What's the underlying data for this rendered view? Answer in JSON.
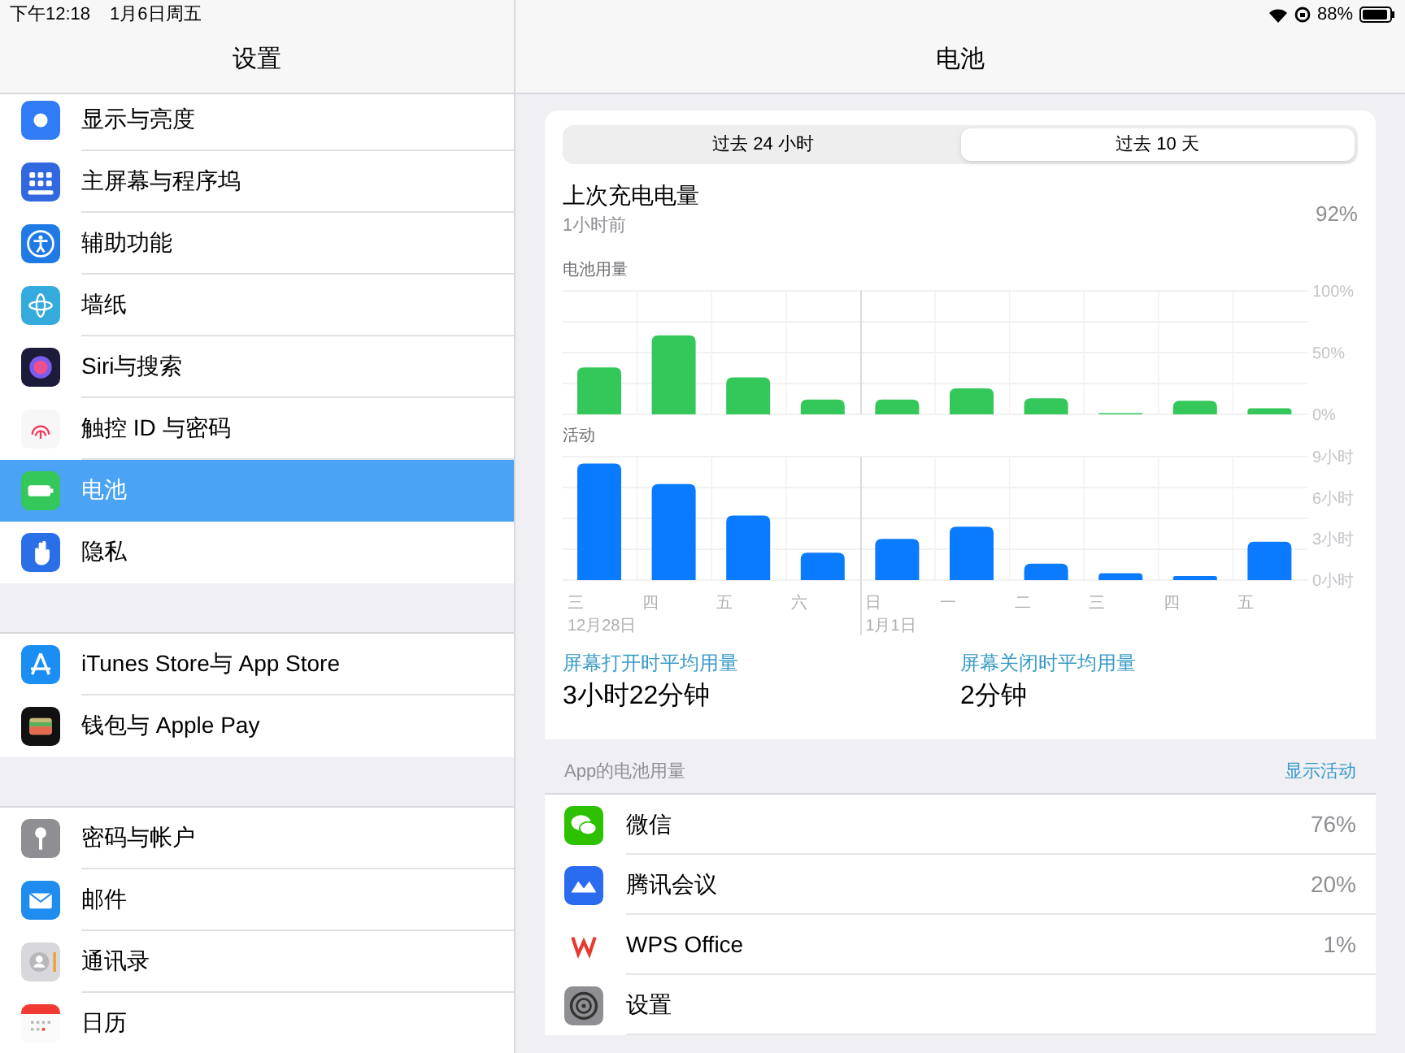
{
  "status_bar": {
    "time": "下午12:18",
    "date": "1月6日周五",
    "battery": "88%"
  },
  "sidebar": {
    "title": "设置",
    "groups": [
      [
        {
          "kind": "display",
          "label": "显示与亮度",
          "selected": false
        },
        {
          "kind": "home",
          "label": "主屏幕与程序坞",
          "selected": false
        },
        {
          "kind": "accessibility",
          "label": "辅助功能",
          "selected": false
        },
        {
          "kind": "wallpaper",
          "label": "墙纸",
          "selected": false
        },
        {
          "kind": "siri",
          "label": "Siri与搜索",
          "selected": false
        },
        {
          "kind": "touchid",
          "label": "触控 ID 与密码",
          "selected": false
        },
        {
          "kind": "battery",
          "label": "电池",
          "selected": true
        },
        {
          "kind": "privacy",
          "label": "隐私",
          "selected": false
        }
      ],
      [
        {
          "kind": "appstore",
          "label": "iTunes Store与 App Store",
          "selected": false
        },
        {
          "kind": "wallet",
          "label": "钱包与 Apple Pay",
          "selected": false
        }
      ],
      [
        {
          "kind": "key",
          "label": "密码与帐户",
          "selected": false
        },
        {
          "kind": "mail",
          "label": "邮件",
          "selected": false
        },
        {
          "kind": "contacts",
          "label": "通讯录",
          "selected": false
        },
        {
          "kind": "calendar",
          "label": "日历",
          "selected": false
        }
      ]
    ]
  },
  "detail": {
    "title": "电池",
    "tabs": [
      {
        "label": "过去 24 小时",
        "selected": false
      },
      {
        "label": "过去 10 天",
        "selected": true
      }
    ],
    "last_charge": {
      "label": "上次充电电量",
      "time": "1小时前",
      "value": "92%"
    },
    "battery_chart": {
      "chart_data": {
        "type": "bar",
        "title": "电池用量",
        "series": [
          {
            "color": "#34c759",
            "values": [
              38,
              64,
              30,
              12,
              12,
              21,
              13,
              1,
              11,
              5
            ]
          }
        ],
        "ylim": [
          0,
          100
        ],
        "yticks": [
          {
            "value": 0,
            "label": "0%"
          },
          {
            "value": 50,
            "label": "50%"
          },
          {
            "value": 100,
            "label": "100%"
          }
        ]
      }
    },
    "activity_chart": {
      "chart_data": {
        "type": "bar",
        "title": "活动",
        "categories": [
          "三",
          "四",
          "五",
          "六",
          "日",
          "一",
          "二",
          "三",
          "四",
          "五"
        ],
        "series": [
          {
            "color": "#0a7aff",
            "values": [
              8.5,
              7,
              4.7,
              2,
              3,
              3.9,
              1.2,
              0.5,
              0.3,
              2.8
            ]
          }
        ],
        "ylim": [
          0,
          9
        ],
        "yticks": [
          {
            "value": 0,
            "label": "0小时"
          },
          {
            "value": 3,
            "label": "3小时"
          },
          {
            "value": 6,
            "label": "6小时"
          },
          {
            "value": 9,
            "label": "9小时"
          }
        ],
        "annotations": [
          "12月28日",
          "1月1日"
        ]
      }
    },
    "stats": [
      {
        "label": "屏幕打开时平均用量",
        "value": "3小时22分钟"
      },
      {
        "label": "屏幕关闭时平均用量",
        "value": "2分钟"
      }
    ],
    "apps_header": {
      "label": "App的电池用量",
      "action": "显示活动"
    },
    "apps": [
      {
        "kind": "wechat",
        "name": "微信",
        "percent": "76%"
      },
      {
        "kind": "meeting",
        "name": "腾讯会议",
        "percent": "20%"
      },
      {
        "kind": "wps",
        "name": "WPS Office",
        "percent": "1%"
      },
      {
        "kind": "settings",
        "name": "设置"
      }
    ]
  }
}
